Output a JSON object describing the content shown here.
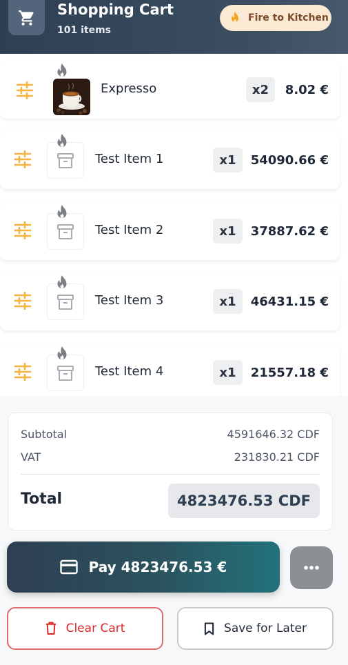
{
  "header": {
    "title": "Shopping Cart",
    "item_count": "101 items",
    "fire_label": "Fire to Kitchen",
    "cart_icon": "cart-icon",
    "fire_icon": "flame-icon"
  },
  "items": [
    {
      "name": "Expresso",
      "qty": "x2",
      "price": "8.02 €",
      "thumb": "espresso-photo"
    },
    {
      "name": "Test Item 1",
      "qty": "x1",
      "price": "54090.66 €",
      "thumb": "archive-box-icon"
    },
    {
      "name": "Test Item 2",
      "qty": "x1",
      "price": "37887.62 €",
      "thumb": "archive-box-icon"
    },
    {
      "name": "Test Item 3",
      "qty": "x1",
      "price": "46431.15 €",
      "thumb": "archive-box-icon"
    },
    {
      "name": "Test Item 4",
      "qty": "x1",
      "price": "21557.18 €",
      "thumb": "archive-box-icon"
    }
  ],
  "summary": {
    "subtotal_label": "Subtotal",
    "subtotal_value": "4591646.32 CDF",
    "vat_label": "VAT",
    "vat_value": "231830.21 CDF",
    "total_label": "Total",
    "total_value": "4823476.53 CDF"
  },
  "actions": {
    "pay_label": "Pay 4823476.53 €",
    "clear_label": "Clear Cart",
    "save_label": "Save for Later"
  },
  "colors": {
    "header": "#2e3f52",
    "accent_orange": "#f5a623",
    "danger": "#dc2626",
    "pay_end": "#22727a"
  }
}
